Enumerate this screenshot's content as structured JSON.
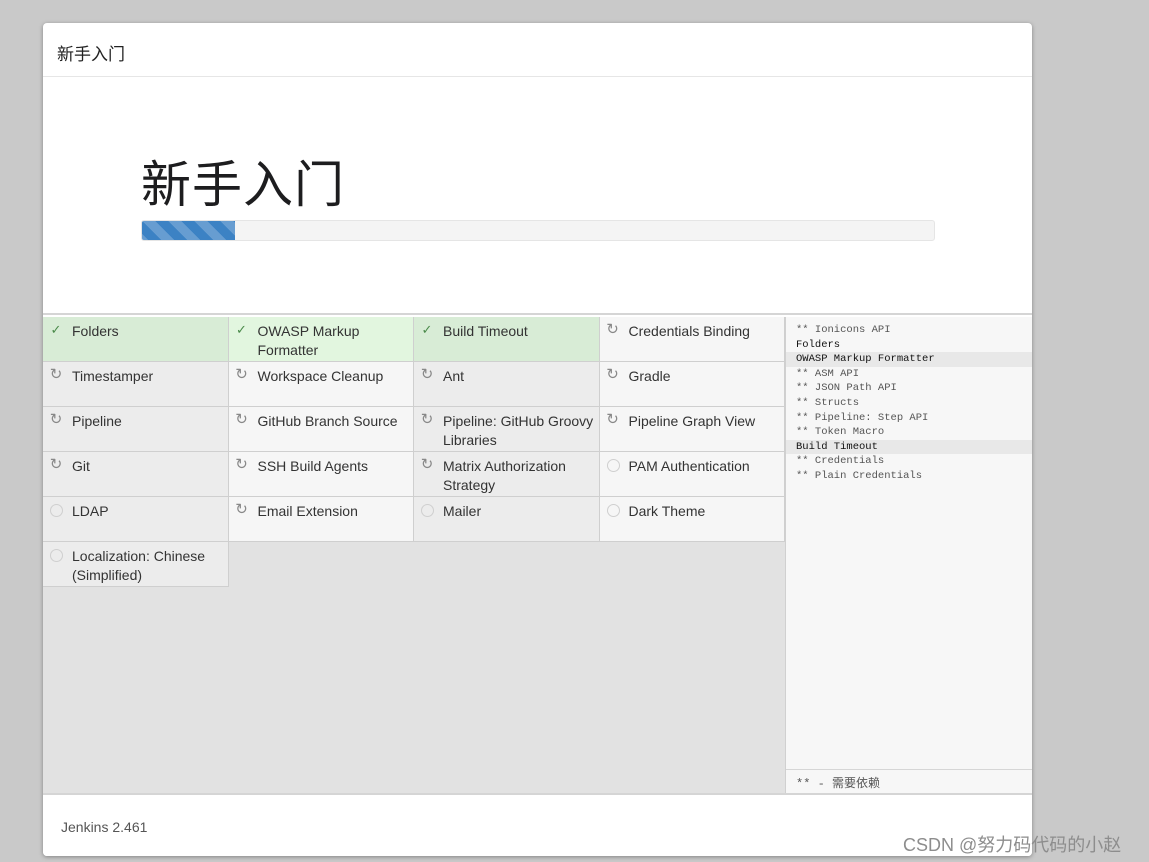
{
  "dialog": {
    "title": "新手入门"
  },
  "jumbotron": {
    "heading": "新手入门",
    "progress_fraction": 0.117
  },
  "plugins": [
    {
      "name": "Folders",
      "status": "done"
    },
    {
      "name": "OWASP Markup Formatter",
      "status": "done"
    },
    {
      "name": "Build Timeout",
      "status": "done"
    },
    {
      "name": "Credentials Binding",
      "status": "installing"
    },
    {
      "name": "Timestamper",
      "status": "installing"
    },
    {
      "name": "Workspace Cleanup",
      "status": "installing"
    },
    {
      "name": "Ant",
      "status": "installing"
    },
    {
      "name": "Gradle",
      "status": "installing"
    },
    {
      "name": "Pipeline",
      "status": "installing"
    },
    {
      "name": "GitHub Branch Source",
      "status": "installing"
    },
    {
      "name": "Pipeline: GitHub Groovy Libraries",
      "status": "installing"
    },
    {
      "name": "Pipeline Graph View",
      "status": "installing"
    },
    {
      "name": "Git",
      "status": "installing"
    },
    {
      "name": "SSH Build Agents",
      "status": "installing"
    },
    {
      "name": "Matrix Authorization Strategy",
      "status": "installing"
    },
    {
      "name": "PAM Authentication",
      "status": "pending"
    },
    {
      "name": "LDAP",
      "status": "pending"
    },
    {
      "name": "Email Extension",
      "status": "installing"
    },
    {
      "name": "Mailer",
      "status": "pending"
    },
    {
      "name": "Dark Theme",
      "status": "pending"
    },
    {
      "name": "Localization: Chinese (Simplified)",
      "status": "pending"
    }
  ],
  "log": {
    "lines": [
      {
        "text": "** Ionicons API",
        "main": false
      },
      {
        "text": "Folders",
        "main": true
      },
      {
        "text": "OWASP Markup Formatter",
        "main": true
      },
      {
        "text": "** ASM API",
        "main": false
      },
      {
        "text": "** JSON Path API",
        "main": false
      },
      {
        "text": "** Structs",
        "main": false
      },
      {
        "text": "** Pipeline: Step API",
        "main": false
      },
      {
        "text": "** Token Macro",
        "main": false
      },
      {
        "text": "Build Timeout",
        "main": true
      },
      {
        "text": "** Credentials",
        "main": false
      },
      {
        "text": "** Plain Credentials",
        "main": false
      }
    ],
    "footer": "** - 需要依赖"
  },
  "footer": {
    "version": "Jenkins 2.461"
  },
  "watermark": "CSDN @努力码代码的小赵",
  "colors": {
    "progress": "#3c82c4",
    "done_bg": "#d8ecd6",
    "check": "#4a8a4a"
  },
  "icons": {
    "done": "check-icon",
    "installing": "refresh-icon",
    "pending": "circle-icon"
  }
}
